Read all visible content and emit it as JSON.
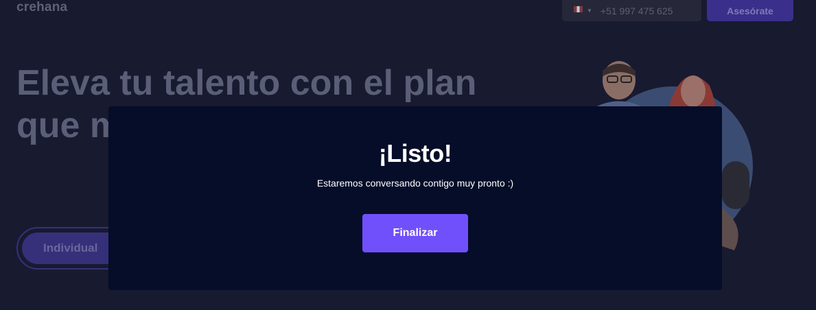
{
  "header": {
    "logo": "crehana",
    "phone": {
      "flag_icon": "peru-flag-icon",
      "number": "+51 997 475 625"
    },
    "advise_label": "Asesórate"
  },
  "hero": {
    "title": "Eleva tu talento con el plan que m neces",
    "toggle": {
      "selected_label": "Individual"
    }
  },
  "modal": {
    "title": "¡Listo!",
    "subtitle": "Estaremos conversando contigo muy pronto :)",
    "button_label": "Finalizar"
  },
  "colors": {
    "background": "#181a30",
    "modal_background": "#060d29",
    "primary_button": "#7050fa",
    "text_white": "#ffffff"
  }
}
